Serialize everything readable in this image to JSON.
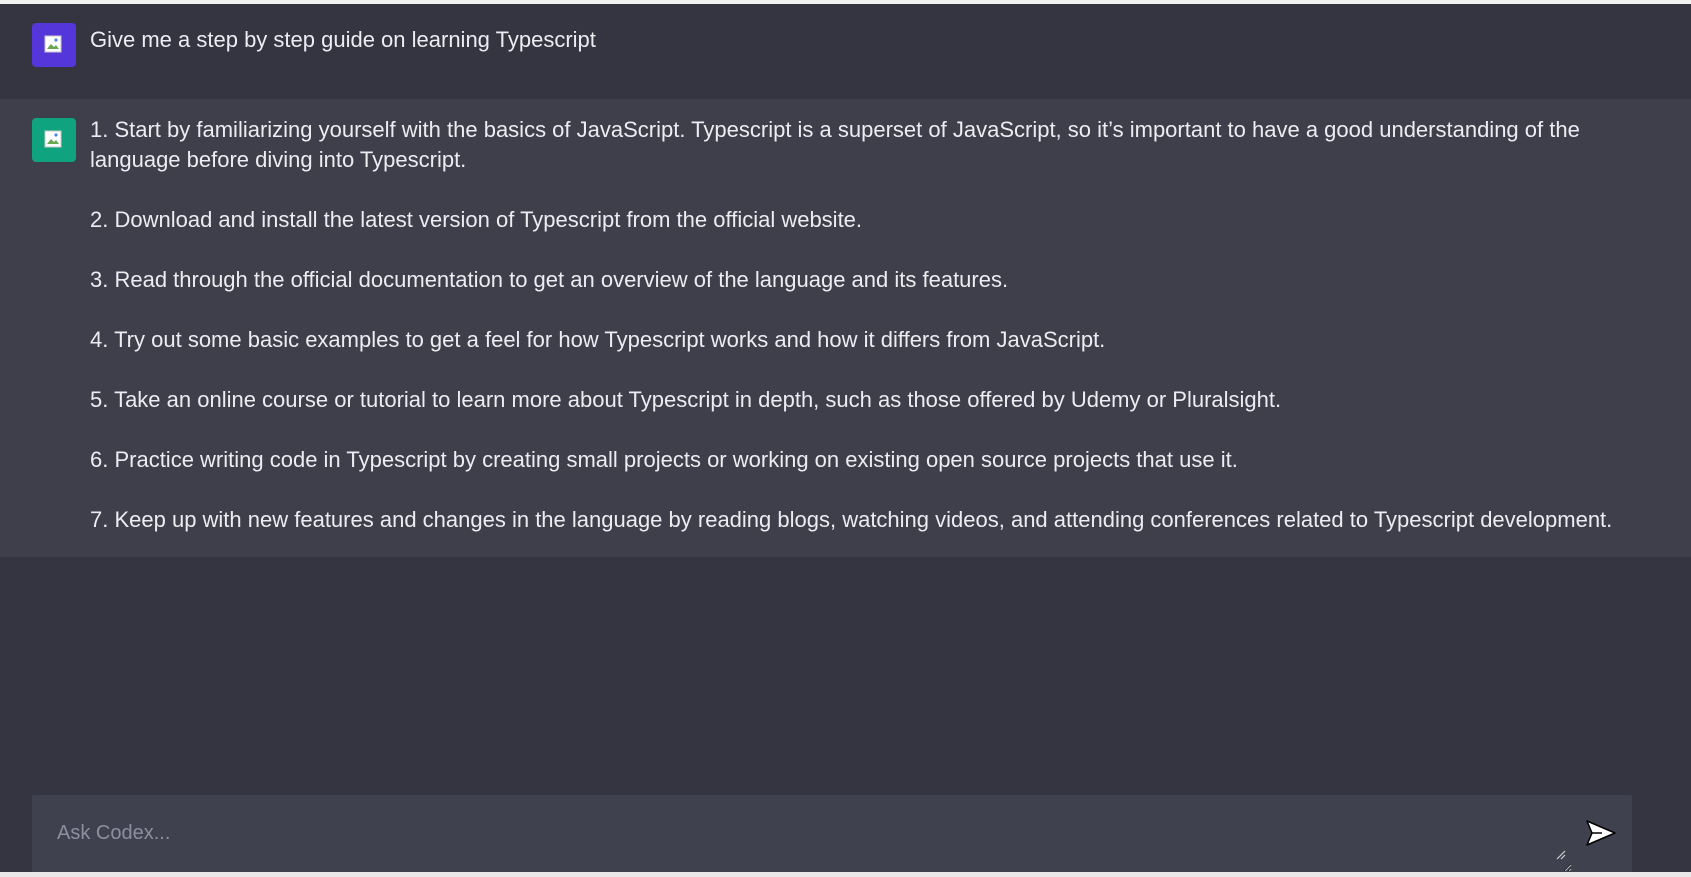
{
  "conversation": {
    "user_message": "Give me a step by step guide on learning Typescript",
    "assistant_steps": [
      "1. Start by familiarizing yourself with the basics of JavaScript. Typescript is a superset of JavaScript, so it’s important to have a good understanding of the language before diving into Typescript.",
      "2. Download and install the latest version of Typescript from the official website.",
      "3. Read through the official documentation to get an overview of the language and its features.",
      "4. Try out some basic examples to get a feel for how Typescript works and how it differs from JavaScript.",
      "5. Take an online course or tutorial to learn more about Typescript in depth, such as those offered by Udemy or Pluralsight.",
      "6. Practice writing code in Typescript by creating small projects or working on existing open source projects that use it.",
      "7. Keep up with new features and changes in the language by reading blogs, watching videos, and attending conferences related to Typescript development."
    ]
  },
  "composer": {
    "placeholder": "Ask Codex...",
    "value": ""
  },
  "icons": {
    "user_avatar": "broken-image-icon",
    "assistant_avatar": "broken-image-icon",
    "send": "send-icon",
    "resize": "resize-handle-icon"
  },
  "colors": {
    "user_avatar_bg": "#5436da",
    "assistant_avatar_bg": "#10a37f",
    "background": "#343541",
    "assistant_row_bg": "#3e3f4b",
    "input_bg": "#40414f"
  }
}
